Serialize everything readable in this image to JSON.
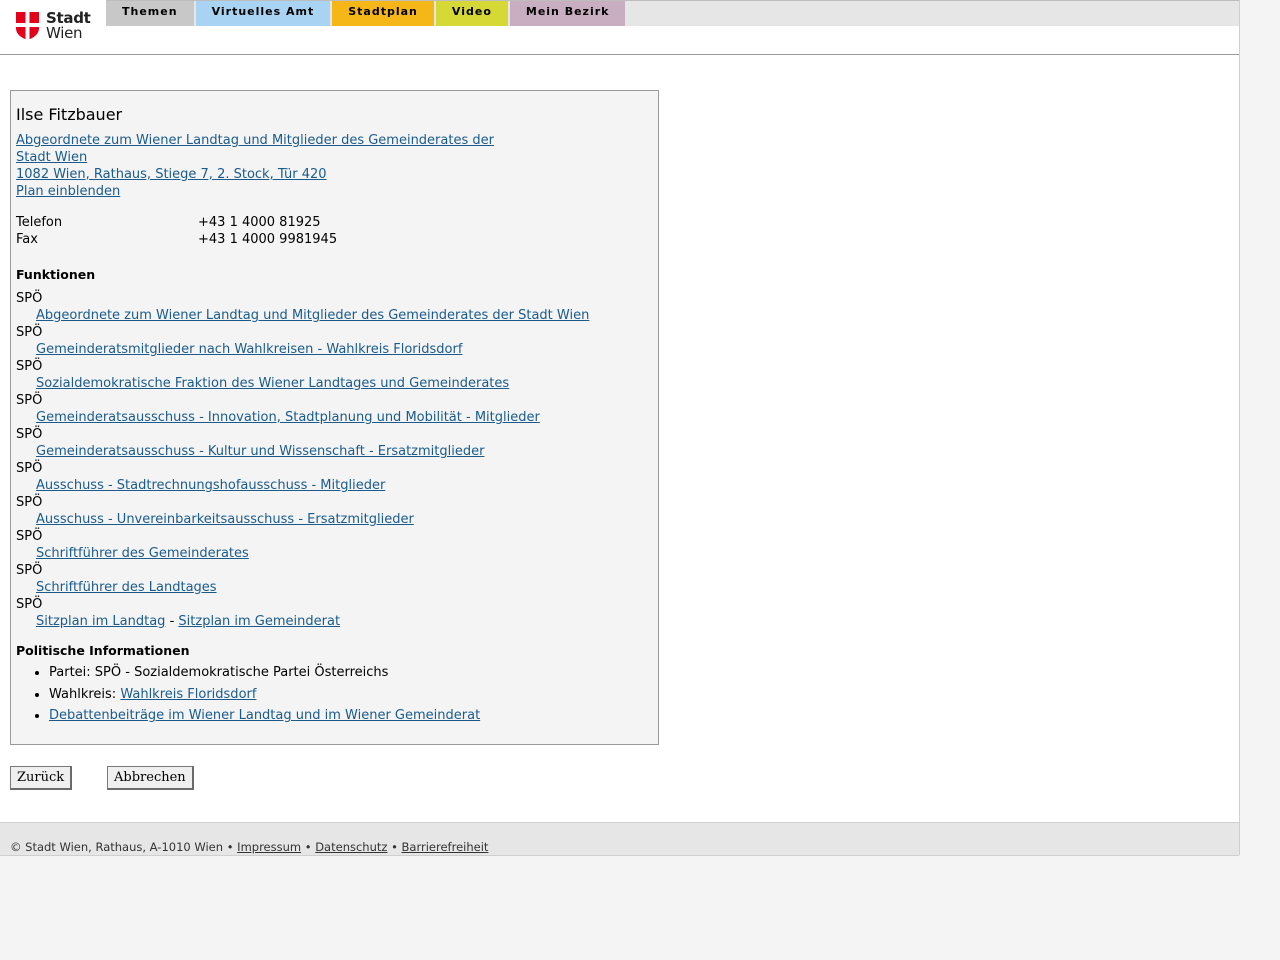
{
  "header": {
    "logo": {
      "line1": "Stadt",
      "line2": "Wien",
      "icon": "vienna-flag-icon",
      "color": "#e2001a"
    },
    "tabs": [
      {
        "label": "Themen",
        "color": "#c8c8c8"
      },
      {
        "label": "Virtuelles Amt",
        "color": "#a9d3f2"
      },
      {
        "label": "Stadtplan",
        "color": "#f5b617"
      },
      {
        "label": "Video",
        "color": "#d5d835"
      },
      {
        "label": "Mein Bezirk",
        "color": "#c9adc0"
      }
    ]
  },
  "person": {
    "name": "Ilse Fitzbauer",
    "affiliation_line1": "Abgeordnete zum Wiener Landtag und Mitglieder des Gemeinderates der",
    "affiliation_line2": "Stadt Wien",
    "address": "1082 Wien, Rathaus, Stiege 7, 2. Stock, Tür 420",
    "plan_link": "Plan einblenden",
    "contact": [
      {
        "label": "Telefon",
        "value": "+43 1 4000 81925"
      },
      {
        "label": "Fax",
        "value": "+43 1 4000 9981945"
      }
    ]
  },
  "functions": {
    "heading": "Funktionen",
    "items": [
      {
        "party": "SPÖ",
        "link": "Abgeordnete zum Wiener Landtag und Mitglieder des Gemeinderates der Stadt Wien"
      },
      {
        "party": "SPÖ",
        "link": "Gemeinderatsmitglieder nach Wahlkreisen - Wahlkreis Floridsdorf"
      },
      {
        "party": "SPÖ",
        "link": "Sozialdemokratische Fraktion des Wiener Landtages und Gemeinderates"
      },
      {
        "party": "SPÖ",
        "link": "Gemeinderatsausschuss - Innovation, Stadtplanung und Mobilität - Mitglieder"
      },
      {
        "party": "SPÖ",
        "link": "Gemeinderatsausschuss - Kultur und Wissenschaft - Ersatzmitglieder"
      },
      {
        "party": "SPÖ",
        "link": "Ausschuss - Stadtrechnungshofausschuss - Mitglieder"
      },
      {
        "party": "SPÖ",
        "link": "Ausschuss - Unvereinbarkeitsausschuss - Ersatzmitglieder"
      },
      {
        "party": "SPÖ",
        "link": "Schriftführer des Gemeinderates"
      },
      {
        "party": "SPÖ",
        "link": "Schriftführer des Landtages"
      }
    ],
    "seating": {
      "party": "SPÖ",
      "link1": "Sitzplan im Landtag",
      "separator": "-",
      "link2": "Sitzplan im Gemeinderat"
    }
  },
  "political": {
    "heading": "Politische Informationen",
    "party_text": "Partei: SPÖ - Sozialdemokratische Partei Österreichs",
    "district_label": "Wahlkreis:",
    "district_link": "Wahlkreis Floridsdorf",
    "debates_link": "Debattenbeiträge im Wiener Landtag und im Wiener Gemeinderat"
  },
  "buttons": {
    "back": "Zurück",
    "cancel": "Abbrechen"
  },
  "footer": {
    "copyright": "© Stadt Wien, Rathaus, A-1010 Wien",
    "bullet": "•",
    "links": [
      "Impressum",
      "Datenschutz",
      "Barrierefreiheit"
    ]
  }
}
